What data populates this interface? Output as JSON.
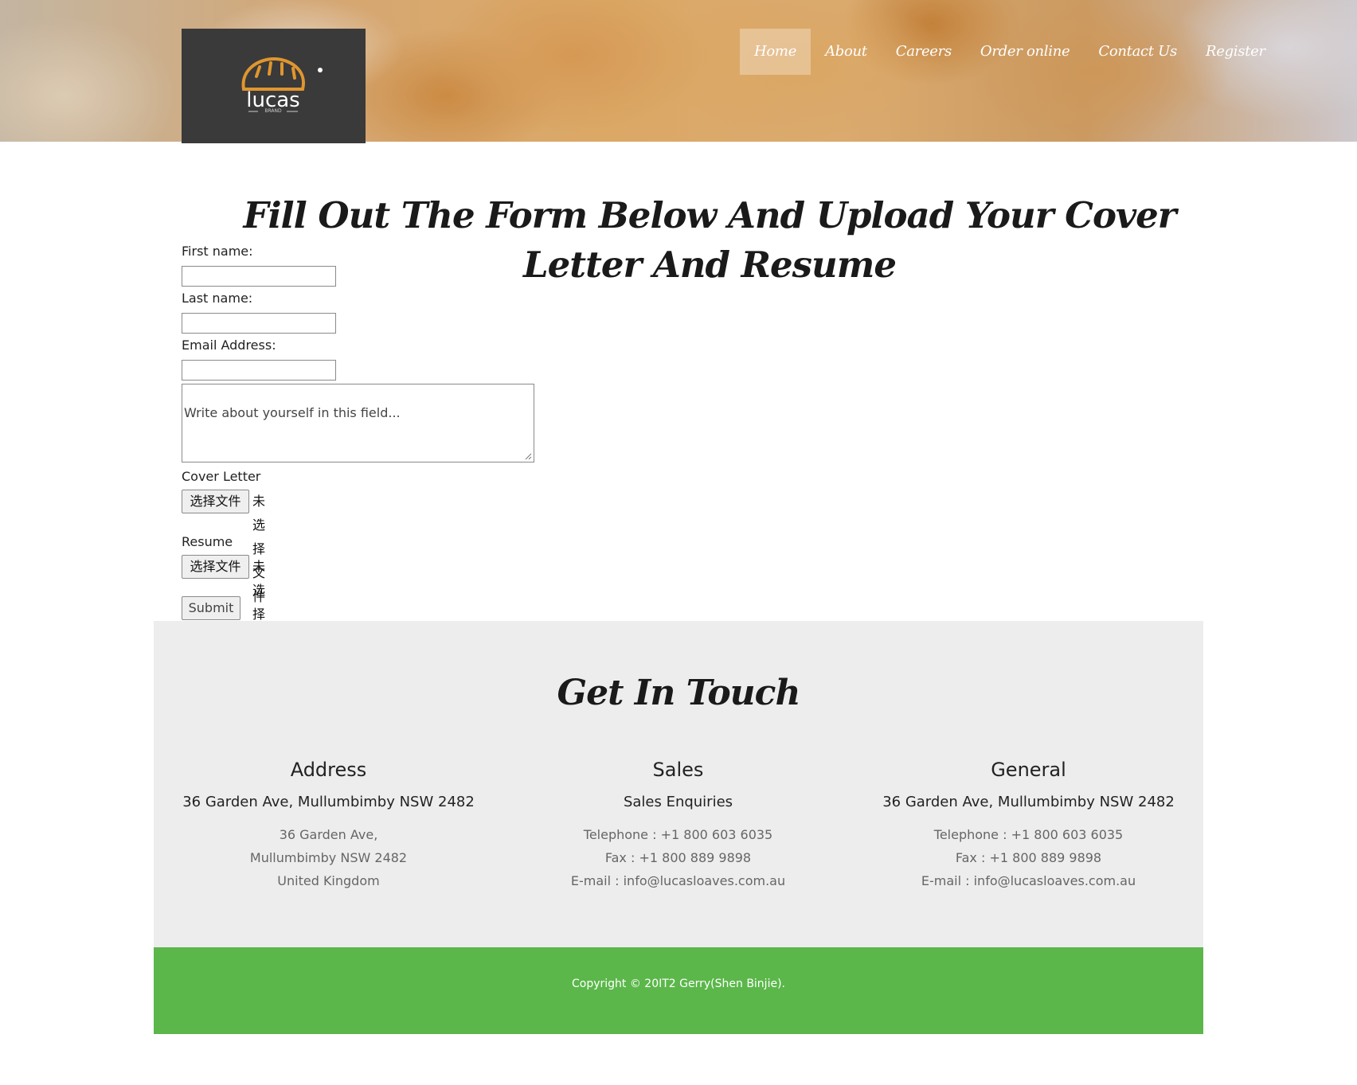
{
  "header": {
    "brand": "lucas",
    "brand_sub": "BRAND",
    "nav": [
      "Home",
      "About",
      "Careers",
      "Order online",
      "Contact Us",
      "Register"
    ]
  },
  "form": {
    "title": "Fill Out The Form Below And Upload Your Cover Letter And Resume",
    "first_name_label": "First name:",
    "last_name_label": "Last name:",
    "email_label": "Email Address:",
    "about_placeholder": "Write about yourself in this field...",
    "cover_letter_label": "Cover Letter",
    "resume_label": "Resume",
    "choose_file": "选择文件",
    "no_file": "未选择文件",
    "submit": "Submit"
  },
  "contact": {
    "title": "Get In Touch",
    "columns": [
      {
        "heading": "Address",
        "sub": "36 Garden Ave, Mullumbimby NSW 2482",
        "lines": [
          "36 Garden Ave,",
          "Mullumbimby NSW 2482",
          "United Kingdom"
        ]
      },
      {
        "heading": "Sales",
        "sub": "Sales Enquiries",
        "lines": [
          "Telephone : +1 800 603 6035",
          "Fax : +1 800 889 9898",
          "E-mail : info@lucasloaves.com.au"
        ]
      },
      {
        "heading": "General",
        "sub": "36 Garden Ave, Mullumbimby NSW 2482",
        "lines": [
          "Telephone : +1 800 603 6035",
          "Fax : +1 800 889 9898",
          "E-mail : info@lucasloaves.com.au"
        ]
      }
    ]
  },
  "copyright": "Copyright © 20IT2 Gerry(Shen Binjie).",
  "colors": {
    "footer_bar": "#5bb74a",
    "logo_accent": "#e0962e",
    "logo_bg": "#3a3a3a"
  }
}
